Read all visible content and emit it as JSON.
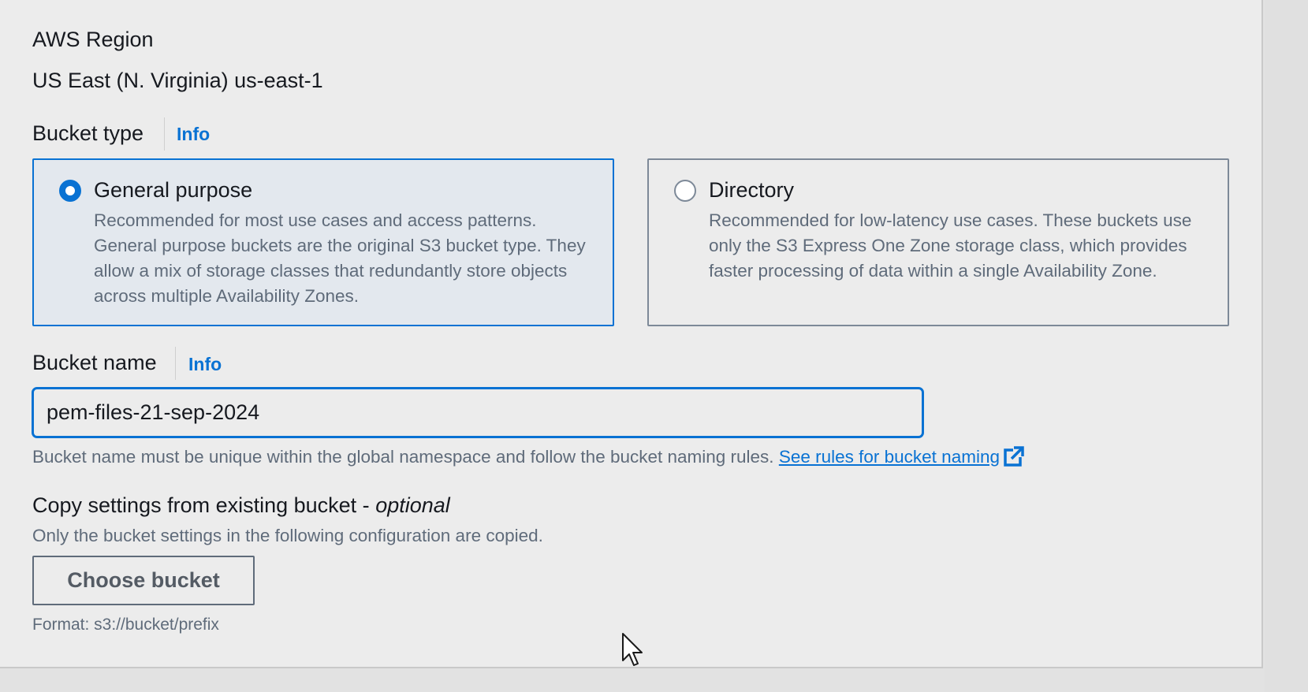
{
  "region": {
    "label": "AWS Region",
    "value": "US East (N. Virginia) us-east-1"
  },
  "bucket_type": {
    "label": "Bucket type",
    "info": "Info",
    "options": [
      {
        "title": "General purpose",
        "description": "Recommended for most use cases and access patterns. General purpose buckets are the original S3 bucket type. They allow a mix of storage classes that redundantly store objects across multiple Availability Zones.",
        "selected": true
      },
      {
        "title": "Directory",
        "description": "Recommended for low-latency use cases. These buckets use only the S3 Express One Zone storage class, which provides faster processing of data within a single Availability Zone.",
        "selected": false
      }
    ]
  },
  "bucket_name": {
    "label": "Bucket name",
    "info": "Info",
    "value": "pem-files-21-sep-2024",
    "hint": "Bucket name must be unique within the global namespace and follow the bucket naming rules.",
    "rules_link": "See rules for bucket naming"
  },
  "copy_settings": {
    "label": "Copy settings from existing bucket - ",
    "label_optional": "optional",
    "description": "Only the bucket settings in the following configuration are copied.",
    "button": "Choose bucket",
    "format": "Format: s3://bucket/prefix"
  },
  "colors": {
    "accent": "#0972d3",
    "text": "#16191f",
    "secondary_text": "#5f6b7a",
    "selected_tile_bg": "#e3e8ee"
  },
  "icons": [
    "external-link-icon",
    "mouse-cursor-icon"
  ]
}
